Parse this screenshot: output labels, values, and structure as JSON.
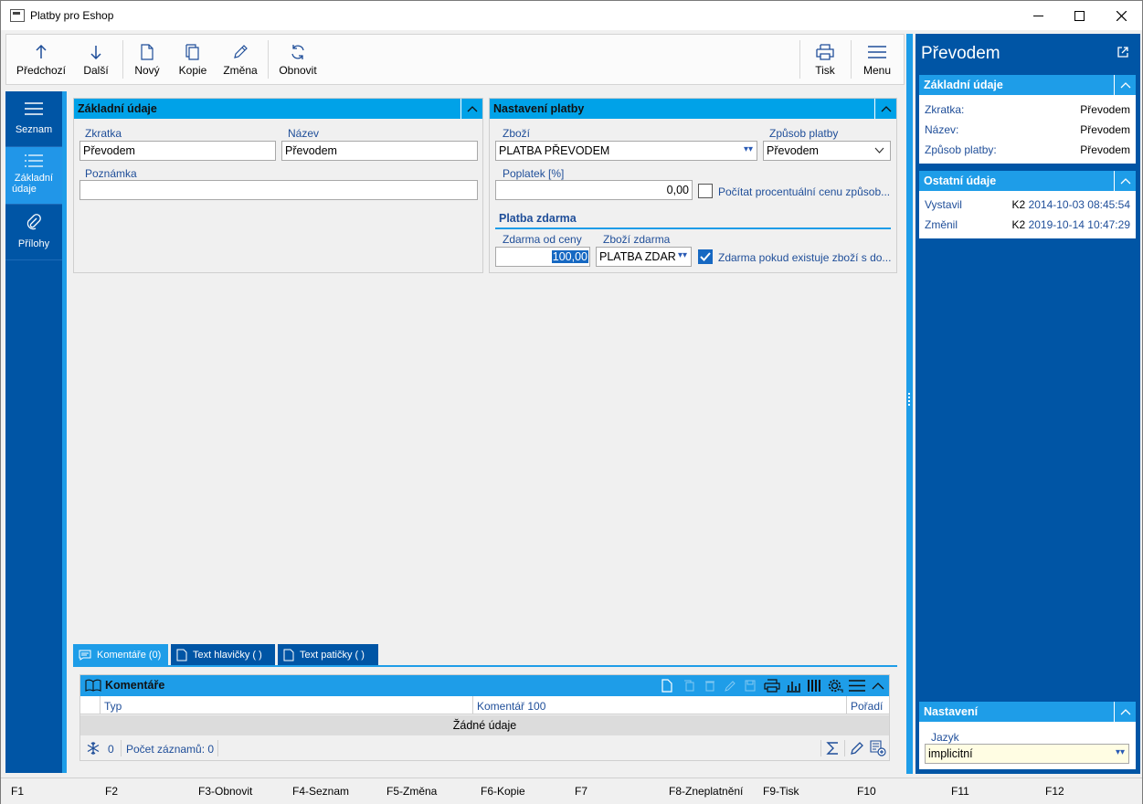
{
  "window": {
    "title": "Platby pro Eshop"
  },
  "toolbar": {
    "prev": "Předchozí",
    "next": "Další",
    "new": "Nový",
    "copy": "Kopie",
    "edit": "Změna",
    "refresh": "Obnovit",
    "print": "Tisk",
    "menu": "Menu"
  },
  "nav": {
    "list": "Seznam",
    "basic_1": "Základní",
    "basic_2": "údaje",
    "attachments": "Přílohy"
  },
  "basic_panel": {
    "title": "Základní údaje",
    "abbr_label": "Zkratka",
    "abbr_value": "Převodem",
    "name_label": "Název",
    "name_value": "Převodem",
    "note_label": "Poznámka",
    "note_value": ""
  },
  "payment_panel": {
    "title": "Nastavení platby",
    "goods_label": "Zboží",
    "goods_value": "PLATBA PŘEVODEM",
    "method_label": "Způsob platby",
    "method_value": "Převodem",
    "fee_label": "Poplatek [%]",
    "fee_value": "0,00",
    "percent_checkbox_label": "Počítat procentuální cenu způsob...",
    "percent_checked": false,
    "free_section": "Platba zdarma",
    "free_from_label": "Zdarma od ceny",
    "free_from_value": "100,00",
    "free_goods_label": "Zboží zdarma",
    "free_goods_value": "PLATBA ZDAR",
    "free_if_checkbox_label": "Zdarma pokud existuje zboží s do...",
    "free_if_checked": true
  },
  "tabs": [
    {
      "label": "Komentáře (0)"
    },
    {
      "label": "Text hlavičky ( )"
    },
    {
      "label": "Text patičky ( )"
    }
  ],
  "comments": {
    "title": "Komentáře",
    "col_type": "Typ",
    "col_comment": "Komentář 100",
    "col_order": "Pořadí",
    "empty": "Žádné údaje",
    "count": "0",
    "records": "Počet záznamů: 0"
  },
  "right_pane": {
    "title": "Převodem",
    "basic": {
      "title": "Základní údaje",
      "rows": [
        {
          "k": "Zkratka:",
          "v": "Převodem"
        },
        {
          "k": "Název:",
          "v": "Převodem"
        },
        {
          "k": "Způsob platby:",
          "v": "Převodem"
        }
      ]
    },
    "other": {
      "title": "Ostatní údaje",
      "rows": [
        {
          "k": "Vystavil",
          "user": "K2",
          "v": "2014-10-03 08:45:54"
        },
        {
          "k": "Změnil",
          "user": "K2",
          "v": "2019-10-14 10:47:29"
        }
      ]
    },
    "settings": {
      "title": "Nastavení",
      "lang_label": "Jazyk",
      "lang_value": "implicitní"
    }
  },
  "fkeys": [
    "F1",
    "F2",
    "F3-Obnovit",
    "F4-Seznam",
    "F5-Změna",
    "F6-Kopie",
    "F7",
    "F8-Zneplatnění",
    "F9-Tisk",
    "F10",
    "F11",
    "F12"
  ],
  "colors": {
    "nav_blue": "#0055a5",
    "accent": "#1e9de8",
    "header": "#00a2e8"
  }
}
